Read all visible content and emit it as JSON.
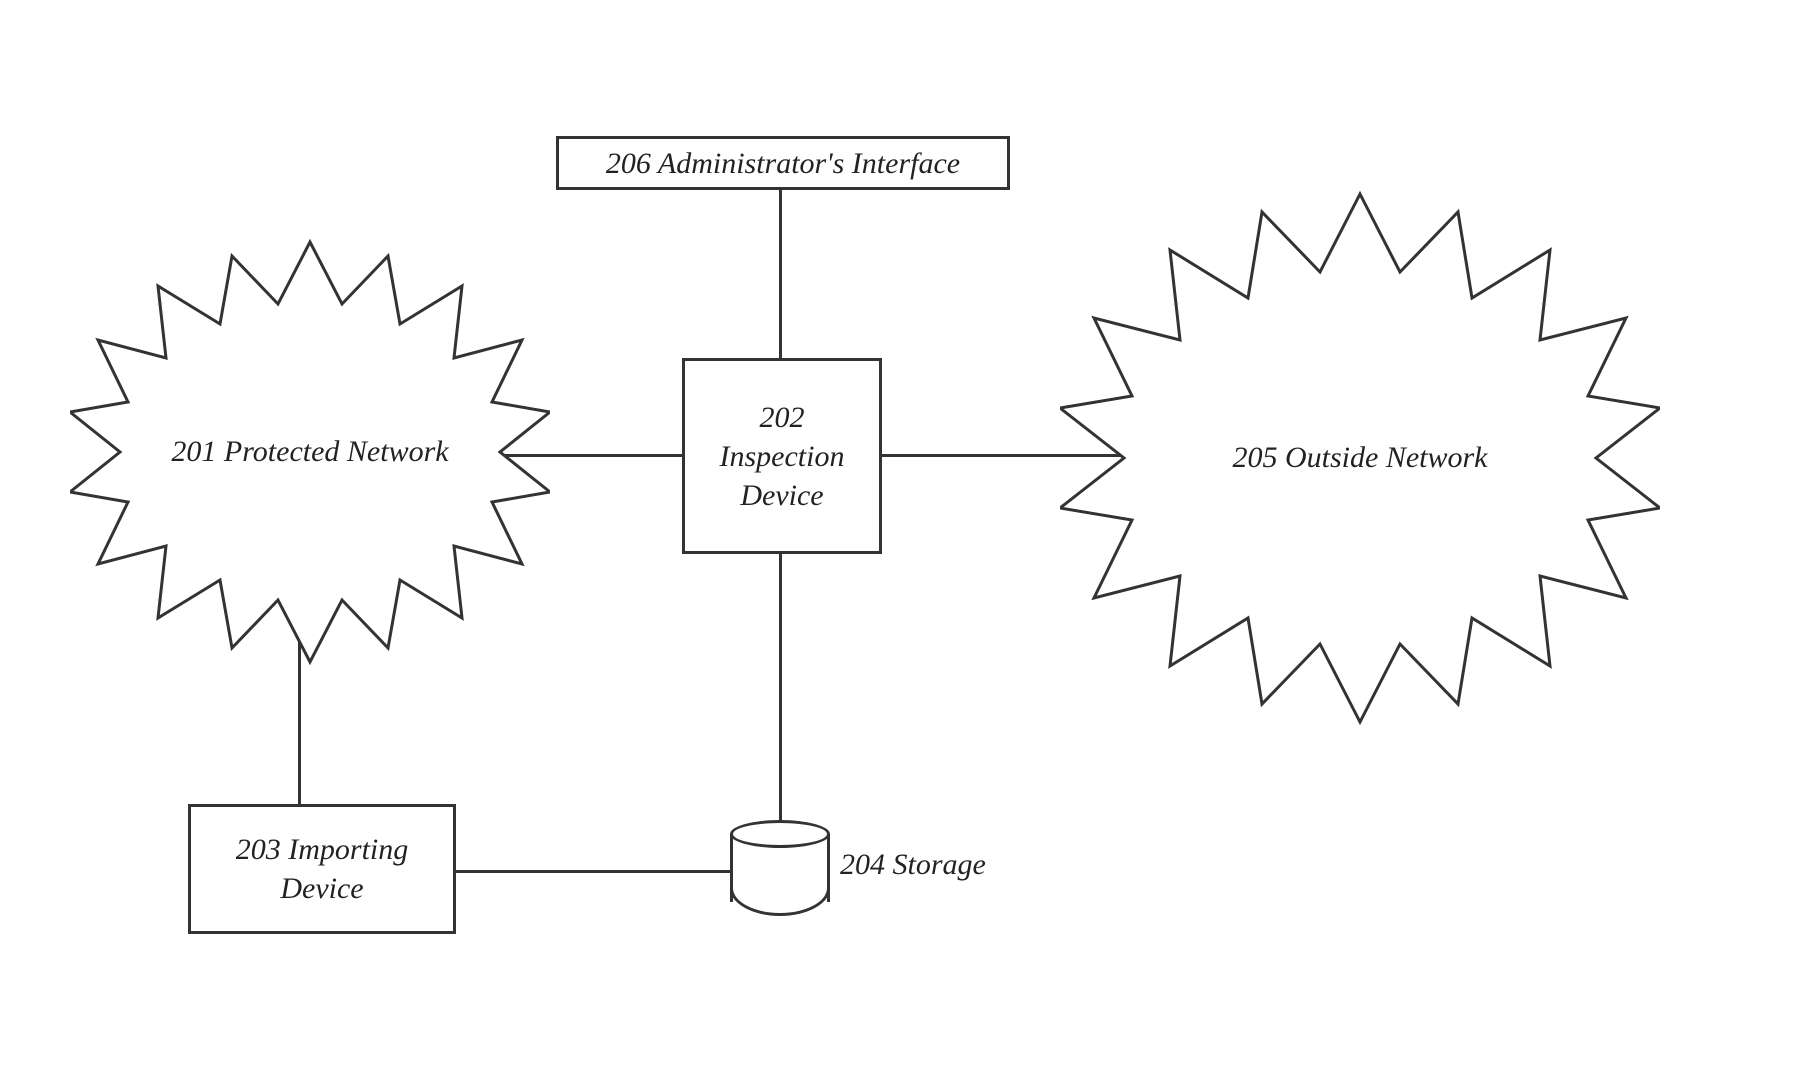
{
  "nodes": {
    "protected_network": {
      "ref": "201",
      "name": "Protected Network"
    },
    "inspection_device": {
      "ref": "202",
      "name": "Inspection Device"
    },
    "importing_device": {
      "ref": "203",
      "name": "Importing Device"
    },
    "storage": {
      "ref": "204",
      "name": "Storage"
    },
    "outside_network": {
      "ref": "205",
      "name": "Outside Network"
    },
    "admin_interface": {
      "ref": "206",
      "name": "Administrator's Interface"
    }
  },
  "labels": {
    "protected_network": "201 Protected Network",
    "inspection_device": "202 Inspection Device",
    "importing_device": "203 Importing Device",
    "storage": "204 Storage",
    "outside_network": "205 Outside Network",
    "admin_interface": "206 Administrator's Interface"
  },
  "edges": [
    [
      "protected_network",
      "inspection_device"
    ],
    [
      "inspection_device",
      "outside_network"
    ],
    [
      "admin_interface",
      "inspection_device"
    ],
    [
      "inspection_device",
      "storage"
    ],
    [
      "importing_device",
      "storage"
    ],
    [
      "protected_network",
      "importing_device"
    ]
  ]
}
